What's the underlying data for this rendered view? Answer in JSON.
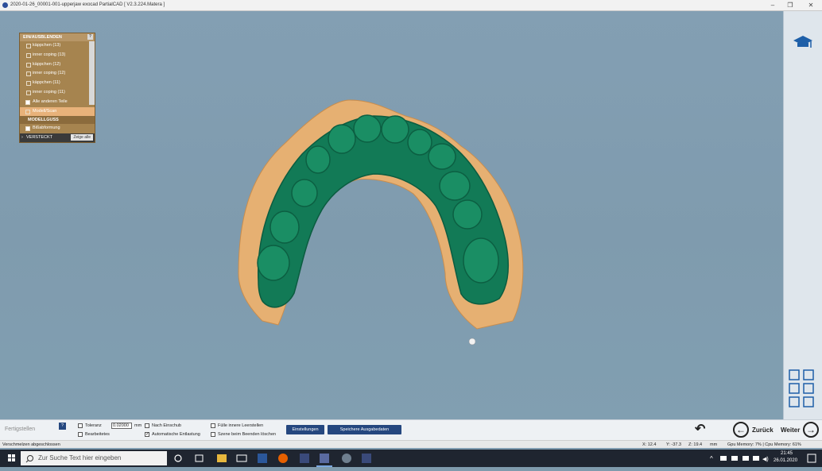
{
  "window": {
    "title": "2020-01-26_00001-001-upperjaw exocad PartialCAD [ V2.3.224.Matera ]",
    "controls": [
      "–",
      "❐",
      "✕"
    ]
  },
  "panel": {
    "header": "EIN/AUSBLENDEN",
    "help": "?",
    "items": [
      {
        "label": "käppchen (13)",
        "checked": false
      },
      {
        "label": "inner coping (13)",
        "checked": false
      },
      {
        "label": "käppchen (12)",
        "checked": false
      },
      {
        "label": "inner coping (12)",
        "checked": false
      },
      {
        "label": "käppchen (11)",
        "checked": false
      },
      {
        "label": "inner coping (11)",
        "checked": false
      }
    ],
    "all_other": "Alle anderen Teile",
    "modell": "Modell/Scan",
    "section2": "MODELLGUSS",
    "section2_item": "Bißabformung",
    "hidden": "VERSTECKT",
    "show_all": "Zeige alle"
  },
  "bottom": {
    "progress_label": "Fertigstellen",
    "help": "?",
    "toleranz_label": "Toleranz",
    "toleranz_value": "0.02000",
    "toleranz_unit": "mm",
    "bearbeitetes": "Bearbeitetes",
    "nach_einschub": "Nach Einschub",
    "auto_entlastung": "Automatische Entlastung",
    "fuelle": "Fülle innere Leerstellen",
    "szene": "Szene beim Beenden löschen",
    "einstellungen": "Einstellungen",
    "speichere": "Speichere Ausgabedaten",
    "zurueck": "Zurück",
    "weiter": "Weiter"
  },
  "status": {
    "message": "Verschmelzen abgeschlossen",
    "x": "X: 12.4",
    "y": "Y: -37.3",
    "z": "Z: 19.4",
    "unit": "mm",
    "gpu": "Gpu Memory: 7% | Cpu Memory: 61%"
  },
  "taskbar": {
    "search_placeholder": "Zur Suche Text hier eingeben",
    "time": "21:45",
    "date": "26.01.2020"
  },
  "colors": {
    "model_orange": "#e6b072",
    "splint_green": "#127a56",
    "background": "#819db0",
    "accent_blue": "#25477f"
  }
}
